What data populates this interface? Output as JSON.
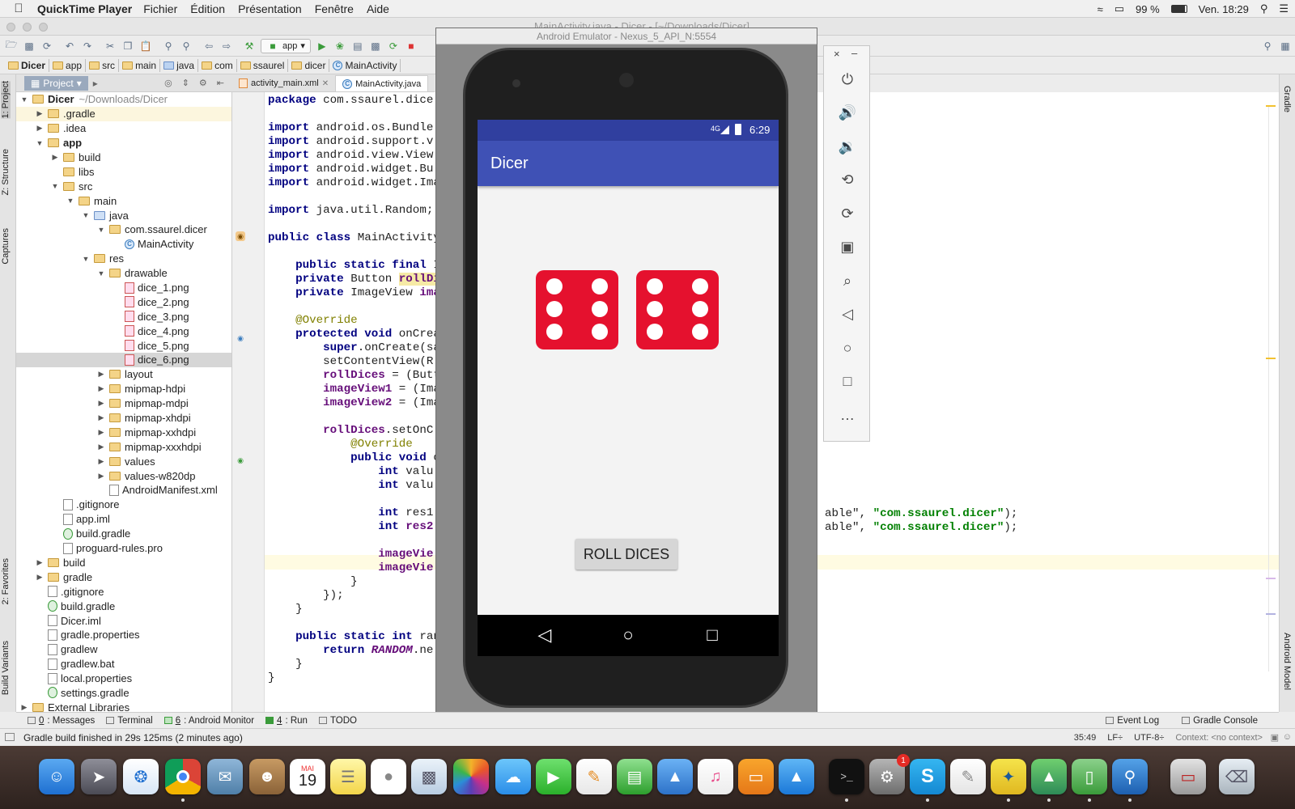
{
  "menubar": {
    "app_name": "QuickTime Player",
    "items": [
      "Fichier",
      "Édition",
      "Présentation",
      "Fenêtre",
      "Aide"
    ],
    "battery": "99 %",
    "clock": "Ven. 18:29"
  },
  "window": {
    "title": "MainActivity.java - Dicer - [~/Downloads/Dicer]"
  },
  "toolbar": {
    "run_config": "app"
  },
  "breadcrumb": [
    "Dicer",
    "app",
    "src",
    "main",
    "java",
    "com",
    "ssaurel",
    "dicer",
    "MainActivity"
  ],
  "left_strip": [
    "1: Project",
    "Z: Structure",
    "Captures",
    "2: Favorites",
    "Build Variants"
  ],
  "right_strip": [
    "Gradle",
    "Android Model"
  ],
  "project": {
    "tab_label": "Project",
    "tree": [
      {
        "name": "Dicer",
        "path": "~/Downloads/Dicer",
        "depth": 0,
        "kind": "folder",
        "open": true,
        "bold": true
      },
      {
        "name": ".gradle",
        "depth": 1,
        "kind": "folder",
        "open": false,
        "hl": true
      },
      {
        "name": ".idea",
        "depth": 1,
        "kind": "folder",
        "open": false
      },
      {
        "name": "app",
        "depth": 1,
        "kind": "folder",
        "open": true,
        "bold": true
      },
      {
        "name": "build",
        "depth": 2,
        "kind": "folder",
        "open": false
      },
      {
        "name": "libs",
        "depth": 2,
        "kind": "folder",
        "leaf": true
      },
      {
        "name": "src",
        "depth": 2,
        "kind": "folder",
        "open": true
      },
      {
        "name": "main",
        "depth": 3,
        "kind": "folder",
        "open": true
      },
      {
        "name": "java",
        "depth": 4,
        "kind": "src",
        "open": true
      },
      {
        "name": "com.ssaurel.dicer",
        "depth": 5,
        "kind": "folder",
        "open": true
      },
      {
        "name": "MainActivity",
        "depth": 6,
        "kind": "class",
        "leaf": true
      },
      {
        "name": "res",
        "depth": 4,
        "kind": "folder",
        "open": true
      },
      {
        "name": "drawable",
        "depth": 5,
        "kind": "folder",
        "open": true
      },
      {
        "name": "dice_1.png",
        "depth": 6,
        "kind": "img",
        "leaf": true
      },
      {
        "name": "dice_2.png",
        "depth": 6,
        "kind": "img",
        "leaf": true
      },
      {
        "name": "dice_3.png",
        "depth": 6,
        "kind": "img",
        "leaf": true
      },
      {
        "name": "dice_4.png",
        "depth": 6,
        "kind": "img",
        "leaf": true
      },
      {
        "name": "dice_5.png",
        "depth": 6,
        "kind": "img",
        "leaf": true
      },
      {
        "name": "dice_6.png",
        "depth": 6,
        "kind": "img",
        "leaf": true,
        "sel": true
      },
      {
        "name": "layout",
        "depth": 5,
        "kind": "folder",
        "open": false
      },
      {
        "name": "mipmap-hdpi",
        "depth": 5,
        "kind": "folder",
        "open": false
      },
      {
        "name": "mipmap-mdpi",
        "depth": 5,
        "kind": "folder",
        "open": false
      },
      {
        "name": "mipmap-xhdpi",
        "depth": 5,
        "kind": "folder",
        "open": false
      },
      {
        "name": "mipmap-xxhdpi",
        "depth": 5,
        "kind": "folder",
        "open": false
      },
      {
        "name": "mipmap-xxxhdpi",
        "depth": 5,
        "kind": "folder",
        "open": false
      },
      {
        "name": "values",
        "depth": 5,
        "kind": "folder",
        "open": false
      },
      {
        "name": "values-w820dp",
        "depth": 5,
        "kind": "folder",
        "open": false
      },
      {
        "name": "AndroidManifest.xml",
        "depth": 5,
        "kind": "file",
        "leaf": true
      },
      {
        "name": ".gitignore",
        "depth": 2,
        "kind": "file",
        "leaf": true
      },
      {
        "name": "app.iml",
        "depth": 2,
        "kind": "file",
        "leaf": true
      },
      {
        "name": "build.gradle",
        "depth": 2,
        "kind": "gradle",
        "leaf": true
      },
      {
        "name": "proguard-rules.pro",
        "depth": 2,
        "kind": "file",
        "leaf": true
      },
      {
        "name": "build",
        "depth": 1,
        "kind": "folder",
        "open": false
      },
      {
        "name": "gradle",
        "depth": 1,
        "kind": "folder",
        "open": false
      },
      {
        "name": ".gitignore",
        "depth": 1,
        "kind": "file",
        "leaf": true
      },
      {
        "name": "build.gradle",
        "depth": 1,
        "kind": "gradle",
        "leaf": true
      },
      {
        "name": "Dicer.iml",
        "depth": 1,
        "kind": "file",
        "leaf": true
      },
      {
        "name": "gradle.properties",
        "depth": 1,
        "kind": "file",
        "leaf": true
      },
      {
        "name": "gradlew",
        "depth": 1,
        "kind": "file",
        "leaf": true
      },
      {
        "name": "gradlew.bat",
        "depth": 1,
        "kind": "file",
        "leaf": true
      },
      {
        "name": "local.properties",
        "depth": 1,
        "kind": "file",
        "leaf": true
      },
      {
        "name": "settings.gradle",
        "depth": 1,
        "kind": "gradle",
        "leaf": true
      },
      {
        "name": "External Libraries",
        "depth": 0,
        "kind": "folder",
        "open": false
      }
    ]
  },
  "editor_tabs": [
    {
      "label": "activity_main.xml",
      "active": false
    },
    {
      "label": "MainActivity.java",
      "active": true
    }
  ],
  "code_lines": [
    [
      [
        "kw",
        "package "
      ],
      [
        "",
        "com.ssaurel.dice"
      ]
    ],
    [],
    [
      [
        "kw",
        "import "
      ],
      [
        "",
        "android.os.Bundle"
      ]
    ],
    [
      [
        "kw",
        "import "
      ],
      [
        "",
        "android.support.v"
      ]
    ],
    [
      [
        "kw",
        "import "
      ],
      [
        "",
        "android.view.View"
      ]
    ],
    [
      [
        "kw",
        "import "
      ],
      [
        "",
        "android.widget.Bu"
      ]
    ],
    [
      [
        "kw",
        "import "
      ],
      [
        "",
        "android.widget.Ima"
      ]
    ],
    [],
    [
      [
        "kw",
        "import "
      ],
      [
        "",
        "java.util.Random;"
      ]
    ],
    [],
    [
      [
        "kw",
        "public class "
      ],
      [
        "",
        "MainActivity"
      ]
    ],
    [],
    [
      [
        "",
        "    "
      ],
      [
        "kw",
        "public static final "
      ],
      [
        "",
        "I"
      ]
    ],
    [
      [
        "",
        "    "
      ],
      [
        "kw",
        "private "
      ],
      [
        "",
        "Button "
      ],
      [
        "fl hy",
        "rollDi"
      ]
    ],
    [
      [
        "",
        "    "
      ],
      [
        "kw",
        "private "
      ],
      [
        "",
        "ImageView "
      ],
      [
        "fl",
        "ima"
      ]
    ],
    [],
    [
      [
        "",
        "    "
      ],
      [
        "an",
        "@Override"
      ]
    ],
    [
      [
        "",
        "    "
      ],
      [
        "kw",
        "protected void "
      ],
      [
        "",
        "onCrea"
      ]
    ],
    [
      [
        "",
        "        "
      ],
      [
        "kw",
        "super"
      ],
      [
        "",
        ".onCreate(sa"
      ]
    ],
    [
      [
        "",
        "        "
      ],
      [
        "",
        "setContentView(R"
      ]
    ],
    [
      [
        "",
        "        "
      ],
      [
        "fl",
        "rollDices"
      ],
      [
        "",
        ""
      ],
      [
        "",
        ""
      ],
      [
        "",
        ""
      ],
      [
        "",
        " = (Butt"
      ]
    ],
    [
      [
        "",
        "        "
      ],
      [
        "fl",
        "imageView1"
      ],
      [
        "",
        " = (Ima"
      ]
    ],
    [
      [
        "",
        "        "
      ],
      [
        "fl",
        "imageView2"
      ],
      [
        "",
        " = (Ima"
      ]
    ],
    [],
    [
      [
        "",
        "        "
      ],
      [
        "fl",
        "rollDices"
      ],
      [
        "",
        ".setOnC"
      ]
    ],
    [
      [
        "",
        "            "
      ],
      [
        "an",
        "@Override"
      ]
    ],
    [
      [
        "",
        "            "
      ],
      [
        "kw",
        "public void "
      ],
      [
        "",
        "o"
      ]
    ],
    [
      [
        "",
        "                "
      ],
      [
        "kw",
        "int "
      ],
      [
        "",
        "valu"
      ]
    ],
    [
      [
        "",
        "                "
      ],
      [
        "kw",
        "int "
      ],
      [
        "",
        "valu"
      ]
    ],
    [],
    [
      [
        "",
        "                "
      ],
      [
        "kw",
        "int "
      ],
      [
        "",
        "res1"
      ]
    ],
    [
      [
        "",
        "                "
      ],
      [
        "kw",
        "int "
      ],
      [
        "fl",
        "res2"
      ]
    ],
    [],
    [
      [
        "",
        "                "
      ],
      [
        "fl",
        "imageVie"
      ]
    ],
    [
      [
        "",
        "                "
      ],
      [
        "fl",
        "imageVie"
      ]
    ],
    [
      [
        "",
        "            "
      ],
      [
        "",
        "}"
      ]
    ],
    [
      [
        "",
        "        "
      ],
      [
        "",
        "});"
      ]
    ],
    [
      [
        "",
        "    "
      ],
      [
        "",
        "}"
      ]
    ],
    [],
    [
      [
        "",
        "    "
      ],
      [
        "kw",
        "public static int "
      ],
      [
        "",
        "ran"
      ]
    ],
    [
      [
        "",
        "        "
      ],
      [
        "kw",
        "return "
      ],
      [
        "it",
        "RANDOM"
      ],
      [
        "",
        ".ne"
      ]
    ],
    [
      [
        "",
        "    "
      ],
      [
        "",
        "}"
      ]
    ],
    [
      [
        "",
        "}"
      ]
    ]
  ],
  "right_code": [
    [
      [
        "",
        "able\", "
      ],
      [
        "st",
        "\"com.ssaurel.dicer\""
      ],
      [
        "",
        ");"
      ]
    ],
    [
      [
        "",
        "able\", "
      ],
      [
        "st",
        "\"com.ssaurel.dicer\""
      ],
      [
        "",
        ");"
      ]
    ]
  ],
  "emulator": {
    "title": "Android Emulator - Nexus_5_API_N:5554",
    "status_signal": "4G",
    "status_time": "6:29",
    "app_title": "Dicer",
    "die_values": [
      6,
      6
    ],
    "button_label": "ROLL DICES"
  },
  "emu_controls": [
    "power-icon",
    "volume-up-icon",
    "volume-down-icon",
    "rotate-left-icon",
    "rotate-right-icon",
    "camera-icon",
    "zoom-icon",
    "back-icon",
    "home-icon",
    "overview-icon",
    "more-icon"
  ],
  "bottom_tabs": [
    {
      "num": "0",
      "label": ": Messages"
    },
    {
      "num": "",
      "label": "Terminal"
    },
    {
      "num": "6",
      "label": ": Android Monitor"
    },
    {
      "num": "4",
      "label": ": Run"
    },
    {
      "num": "",
      "label": "TODO"
    }
  ],
  "bottom_right_tabs": [
    "Event Log",
    "Gradle Console"
  ],
  "statusbar": {
    "message": "Gradle build finished in 29s 125ms (2 minutes ago)",
    "position": "35:49",
    "line_sep": "LF÷",
    "encoding": "UTF-8÷",
    "context": "Context: <no context>"
  },
  "dock": {
    "calendar_month": "MAI",
    "calendar_day": "19",
    "badge_count": "1"
  }
}
